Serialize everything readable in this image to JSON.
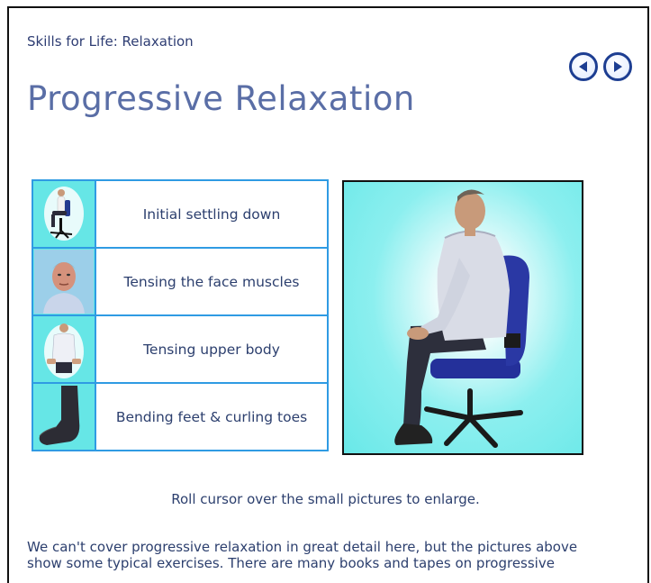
{
  "header": {
    "breadcrumb": "Skills for Life: Relaxation",
    "title": "Progressive Relaxation"
  },
  "nav": {
    "prev_icon": "back-arrow-icon",
    "next_icon": "forward-arrow-icon"
  },
  "steps": [
    {
      "label": "Initial settling down",
      "thumb": "seated-man-thumbnail"
    },
    {
      "label": "Tensing the face muscles",
      "thumb": "face-tensing-thumbnail"
    },
    {
      "label": "Tensing upper body",
      "thumb": "upper-body-thumbnail"
    },
    {
      "label": "Bending feet & curling toes",
      "thumb": "foot-curl-thumbnail"
    }
  ],
  "preview": {
    "image": "man-sitting-in-office-chair"
  },
  "hint": "Roll cursor over the small pictures to enlarge.",
  "body": {
    "line1": "We can't cover progressive relaxation in great detail here, but the pictures above",
    "line2": "show some typical exercises. There are many books and tapes on progressive"
  },
  "colors": {
    "accent": "#2f9be3",
    "title": "#5a6ea6",
    "preview_bg": "#69e8e8",
    "nav": "#1d3e92"
  }
}
